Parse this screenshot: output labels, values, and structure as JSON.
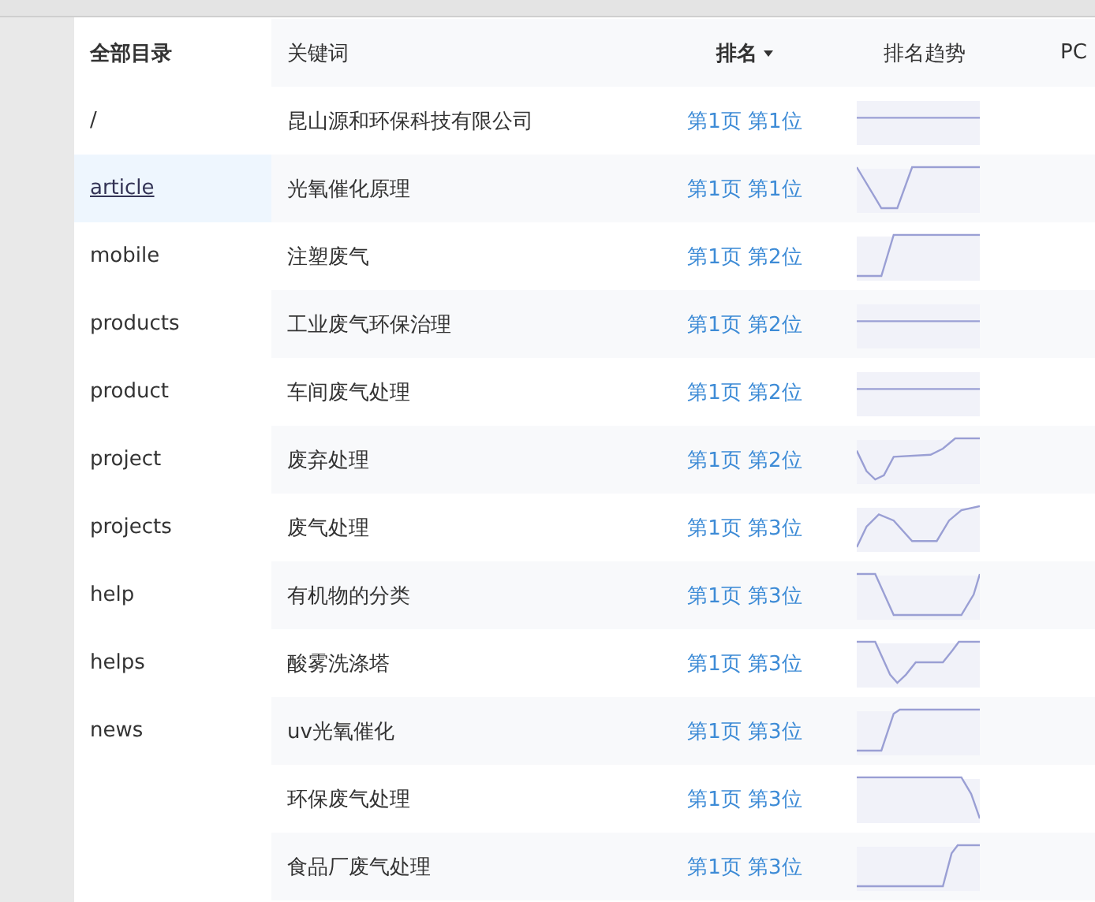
{
  "sidebar": {
    "title": "全部目录",
    "items": [
      {
        "label": "/",
        "selected": false
      },
      {
        "label": "article",
        "selected": true
      },
      {
        "label": "mobile",
        "selected": false
      },
      {
        "label": "products",
        "selected": false
      },
      {
        "label": "product",
        "selected": false
      },
      {
        "label": "project",
        "selected": false
      },
      {
        "label": "projects",
        "selected": false
      },
      {
        "label": "help",
        "selected": false
      },
      {
        "label": "helps",
        "selected": false
      },
      {
        "label": "news",
        "selected": false
      }
    ]
  },
  "table": {
    "columns": [
      "关键词",
      "排名",
      "排名趋势",
      "PC"
    ],
    "rows": [
      {
        "keyword": "昆山源和环保科技有限公司",
        "rank": "第1页 第1位"
      },
      {
        "keyword": "光氧催化原理",
        "rank": "第1页 第1位"
      },
      {
        "keyword": "注塑废气",
        "rank": "第1页 第2位"
      },
      {
        "keyword": "工业废气环保治理",
        "rank": "第1页 第2位"
      },
      {
        "keyword": "车间废气处理",
        "rank": "第1页 第2位"
      },
      {
        "keyword": "废弃处理",
        "rank": "第1页 第2位"
      },
      {
        "keyword": "废气处理",
        "rank": "第1页 第3位"
      },
      {
        "keyword": "有机物的分类",
        "rank": "第1页 第3位"
      },
      {
        "keyword": "酸雾洗涤塔",
        "rank": "第1页 第3位"
      },
      {
        "keyword": "uv光氧催化",
        "rank": "第1页 第3位"
      },
      {
        "keyword": "环保废气处理",
        "rank": "第1页 第3位"
      },
      {
        "keyword": "食品厂废气处理",
        "rank": "第1页 第3位"
      }
    ]
  }
}
